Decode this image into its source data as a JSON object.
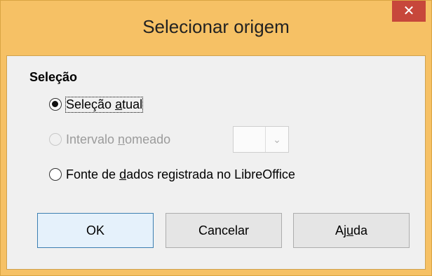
{
  "window": {
    "title": "Selecionar origem",
    "close_glyph": "✕"
  },
  "selection": {
    "group_label": "Seleção",
    "options": [
      {
        "pre": "Seleção ",
        "mnemonic": "a",
        "post": "tual",
        "checked": true,
        "enabled": true
      },
      {
        "pre": "Intervalo ",
        "mnemonic": "n",
        "post": "omeado",
        "checked": false,
        "enabled": false
      },
      {
        "pre": "Fonte de ",
        "mnemonic": "d",
        "post": "ados registrada no LibreOffice",
        "checked": false,
        "enabled": true
      }
    ],
    "range_combo": {
      "value": "",
      "arrow_icon": "chevron-down-icon",
      "arrow_glyph": "⌄"
    }
  },
  "buttons": {
    "ok": {
      "label": "OK"
    },
    "cancel": {
      "label": "Cancelar"
    },
    "help": {
      "pre": "Aj",
      "mnemonic": "u",
      "post": "da"
    }
  },
  "colors": {
    "title_bar": "#f6c165",
    "close_button": "#c7473b",
    "default_button_border": "#3c7fb1"
  }
}
